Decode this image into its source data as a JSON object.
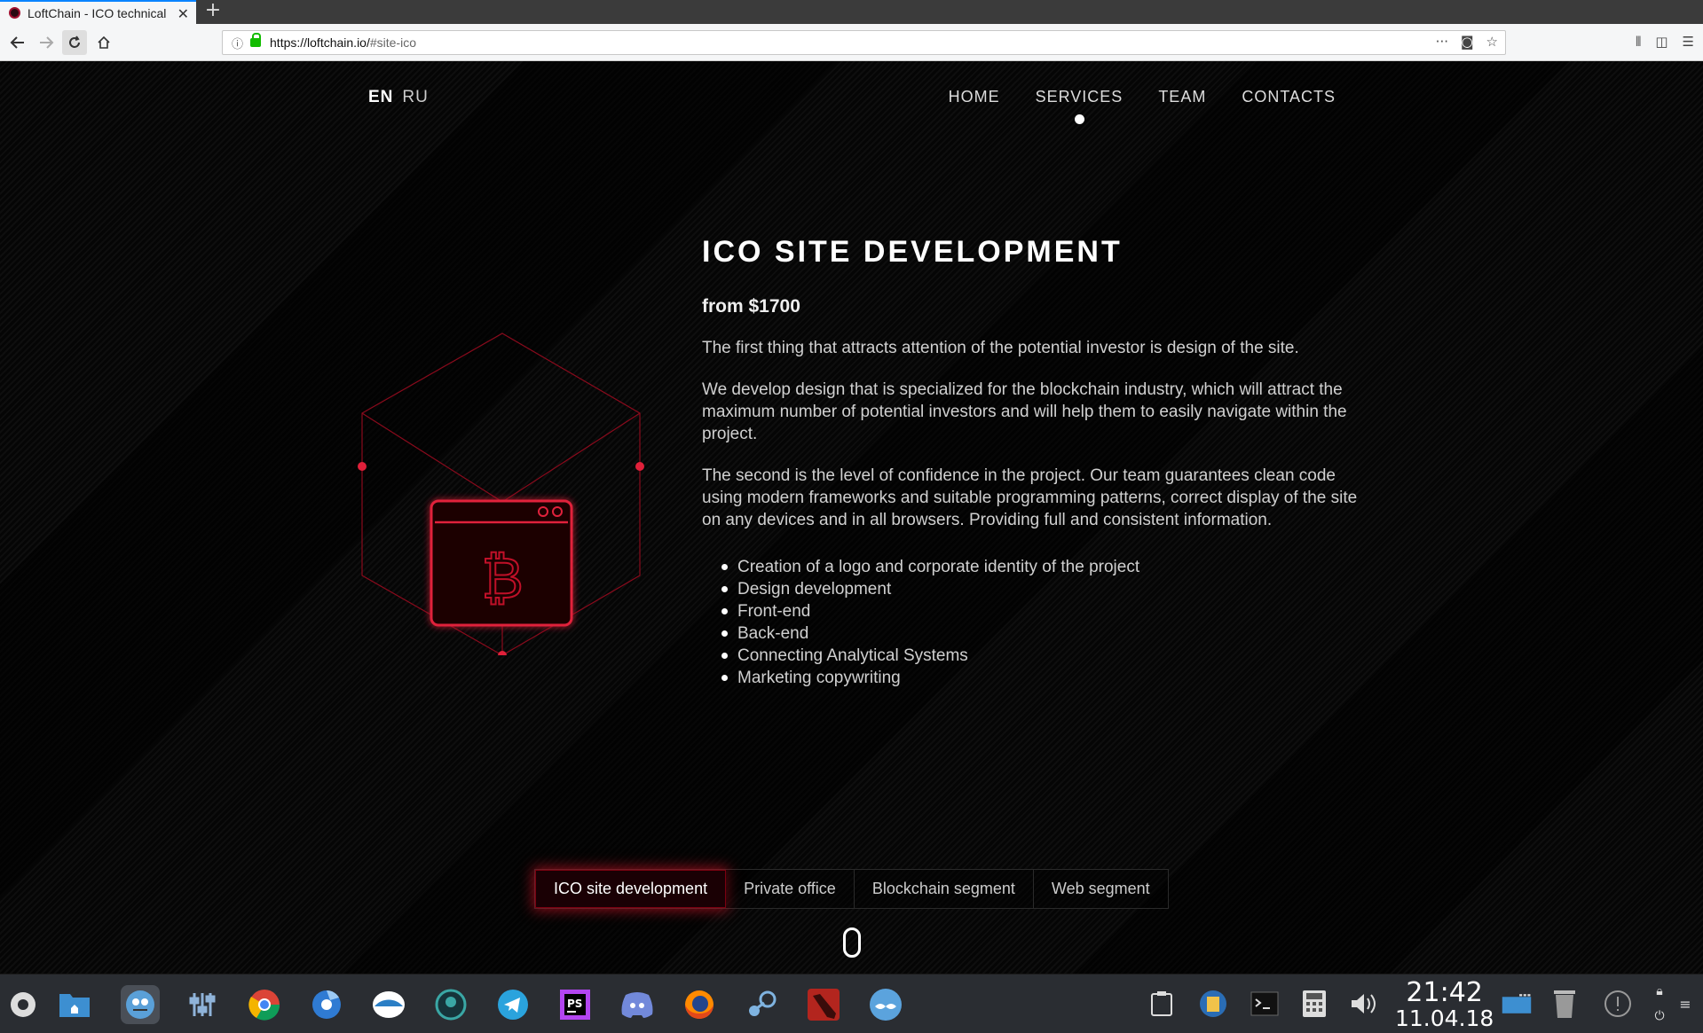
{
  "browser": {
    "tab_title": "LoftChain - ICO technical",
    "new_tab": "+",
    "url_host": "https://loftchain.io/",
    "url_path": "#site-ico"
  },
  "site": {
    "lang": {
      "active": "EN",
      "other": "RU"
    },
    "menu": [
      {
        "label": "HOME"
      },
      {
        "label": "SERVICES",
        "active": true
      },
      {
        "label": "TEAM"
      },
      {
        "label": "CONTACTS"
      }
    ],
    "title": "ICO SITE DEVELOPMENT",
    "price": "from $1700",
    "paragraphs": [
      "The first thing that attracts attention of the potential investor is design of the site.",
      "We develop design that is specialized for the blockchain industry, which will attract the maximum number of potential investors and will help them to easily navigate within the project.",
      "The second is the level of confidence in the project. Our team guarantees clean code using modern frameworks and suitable programming patterns, correct display of the site on any devices and in all browsers. Providing full and consistent information."
    ],
    "features": [
      "Creation of a logo and corporate identity of the project",
      "Design development",
      "Front-end",
      "Back-end",
      "Connecting Analytical Systems",
      "Marketing copywriting"
    ],
    "service_tabs": [
      {
        "label": "ICO site development",
        "active": true
      },
      {
        "label": "Private office"
      },
      {
        "label": "Blockchain segment"
      },
      {
        "label": "Web segment"
      }
    ],
    "accent_color": "#e0203a"
  },
  "taskbar": {
    "time": "21:42",
    "date": "11.04.18",
    "ps_label": "PS"
  }
}
